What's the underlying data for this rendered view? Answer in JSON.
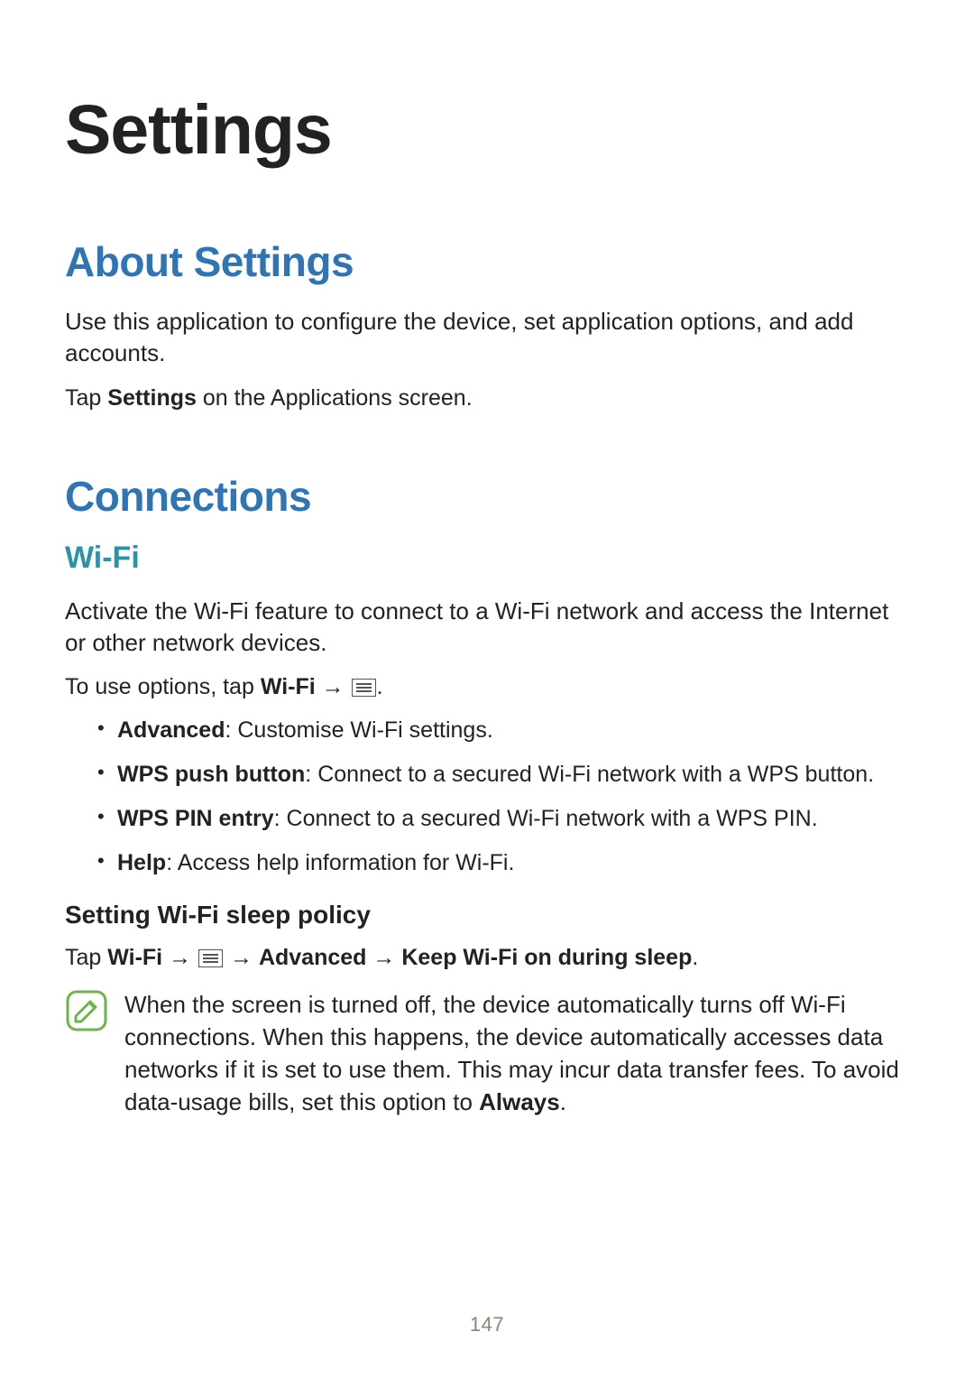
{
  "page_number": "147",
  "title": "Settings",
  "sections": {
    "about": {
      "heading": "About Settings",
      "p1": "Use this application to configure the device, set application options, and add accounts.",
      "tap_prefix": "Tap ",
      "tap_bold": "Settings",
      "tap_suffix": " on the Applications screen."
    },
    "connections": {
      "heading": "Connections",
      "wifi": {
        "heading": "Wi-Fi",
        "intro": "Activate the Wi-Fi feature to connect to a Wi-Fi network and access the Internet or other network devices.",
        "options_sentence": {
          "prefix": "To use options, tap ",
          "bold1": "Wi-Fi",
          "arrow": " → ",
          "period": "."
        },
        "options": [
          {
            "bold": "Advanced",
            "rest": ": Customise Wi-Fi settings."
          },
          {
            "bold": "WPS push button",
            "rest": ": Connect to a secured Wi-Fi network with a WPS button."
          },
          {
            "bold": "WPS PIN entry",
            "rest": ": Connect to a secured Wi-Fi network with a WPS PIN."
          },
          {
            "bold": "Help",
            "rest": ": Access help information for Wi-Fi."
          }
        ],
        "sleep": {
          "heading": "Setting Wi-Fi sleep policy",
          "path": {
            "prefix": "Tap ",
            "b1": "Wi-Fi",
            "sep1": " → ",
            "sep2": " → ",
            "b2": "Advanced",
            "sep3": " → ",
            "b3": "Keep Wi-Fi on during sleep",
            "period": "."
          },
          "note": {
            "body": "When the screen is turned off, the device automatically turns off Wi-Fi connections. When this happens, the device automatically accesses data networks if it is set to use them. This may incur data transfer fees. To avoid data-usage bills, set this option to ",
            "bold": "Always",
            "suffix": "."
          }
        }
      }
    }
  }
}
